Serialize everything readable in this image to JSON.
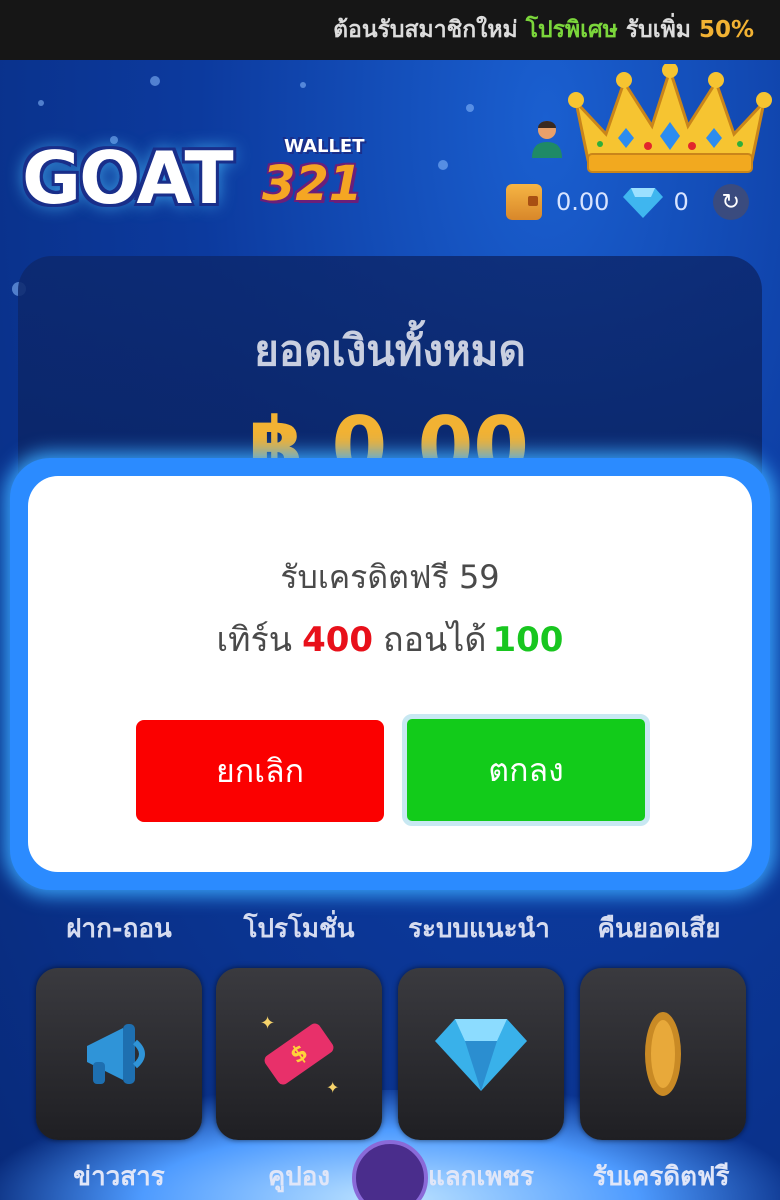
{
  "marquee": {
    "part1": "ต้อนรับสมาชิกใหม่",
    "part2": "โปรพิเศษ",
    "part3": "รับเพิ่ม",
    "part4": "50%"
  },
  "logo": {
    "brand": "GOAT",
    "wallet": "WALLET",
    "number": "321"
  },
  "wallet": {
    "balance": "0.00",
    "diamonds": "0",
    "refresh_icon": "↻"
  },
  "balance_panel": {
    "title": "ยอดเงินทั้งหมด",
    "amount": "฿ 0.00"
  },
  "modal": {
    "line1": "รับเครดิตฟรี 59",
    "line2_prefix": "เทิร์น",
    "turnover": "400",
    "line2_mid": "ถอนได้",
    "withdraw": "100",
    "cancel_label": "ยกเลิก",
    "ok_label": "ตกลง"
  },
  "menu_row1": [
    "ฝาก-ถอน",
    "โปรโมชั่น",
    "ระบบแนะนำ",
    "คืนยอดเสีย"
  ],
  "menu_row2": [
    "ข่าวสาร",
    "คูปอง",
    "แลกเพชร",
    "รับเครดิตฟรี"
  ],
  "colors": {
    "accent_red": "#fb0000",
    "accent_green": "#12cb1a",
    "gold": "#f2b233",
    "background": "#0c3a9e"
  }
}
